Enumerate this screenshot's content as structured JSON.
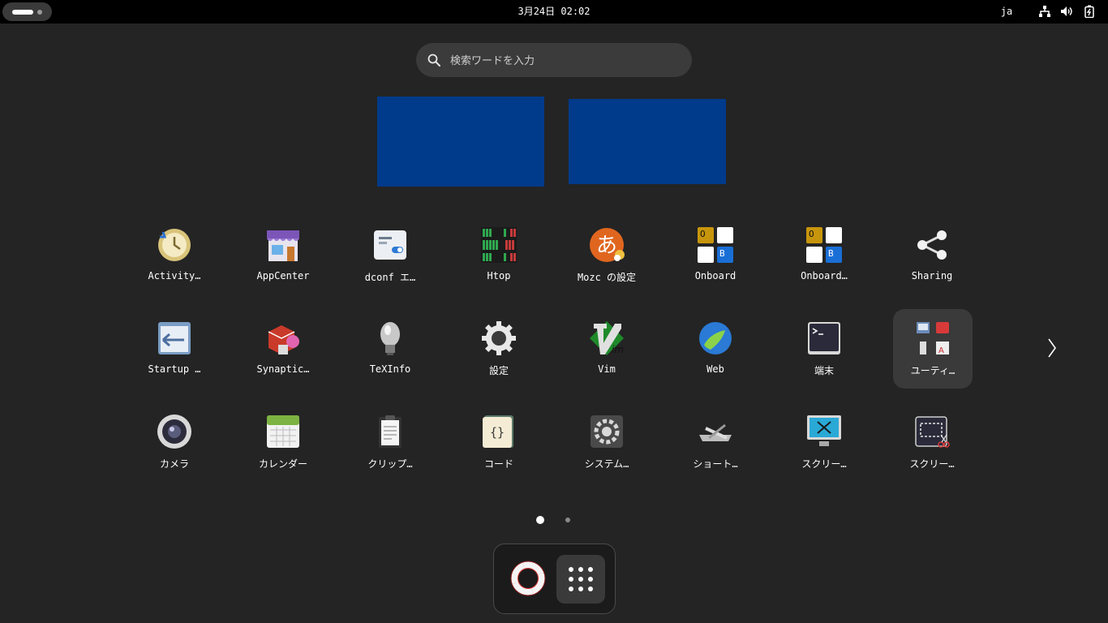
{
  "topbar": {
    "clock": "3月24日  02:02",
    "input_language": "ja",
    "tray_icons": [
      "network-icon",
      "volume-icon",
      "battery-icon"
    ]
  },
  "search": {
    "placeholder": "検索ワードを入力"
  },
  "apps_row1": [
    "Activity…",
    "AppCenter",
    "dconf エ…",
    "Htop",
    "Mozc の設定",
    "Onboard",
    "Onboard…",
    "Sharing"
  ],
  "apps_row2": [
    "Startup …",
    "Synaptic…",
    "TeXInfo",
    "設定",
    "Vim",
    "Web",
    "端末",
    "ユーティ…"
  ],
  "apps_row3": [
    "カメラ",
    "カレンダー",
    "クリップ…",
    "コード",
    "システム…",
    "ショート…",
    "スクリー…",
    "スクリー…"
  ],
  "onboard_icon_letters": {
    "top_left": "O",
    "bottom_right": "B"
  },
  "pagination": {
    "current_page": 1,
    "total_pages": 2
  },
  "dash": {
    "items": [
      "help-icon",
      "show-apps-icon"
    ]
  },
  "colors": {
    "background": "#242424",
    "topbar": "#000000",
    "workspace": "#003a8a",
    "highlight": "#3a3a3a"
  }
}
